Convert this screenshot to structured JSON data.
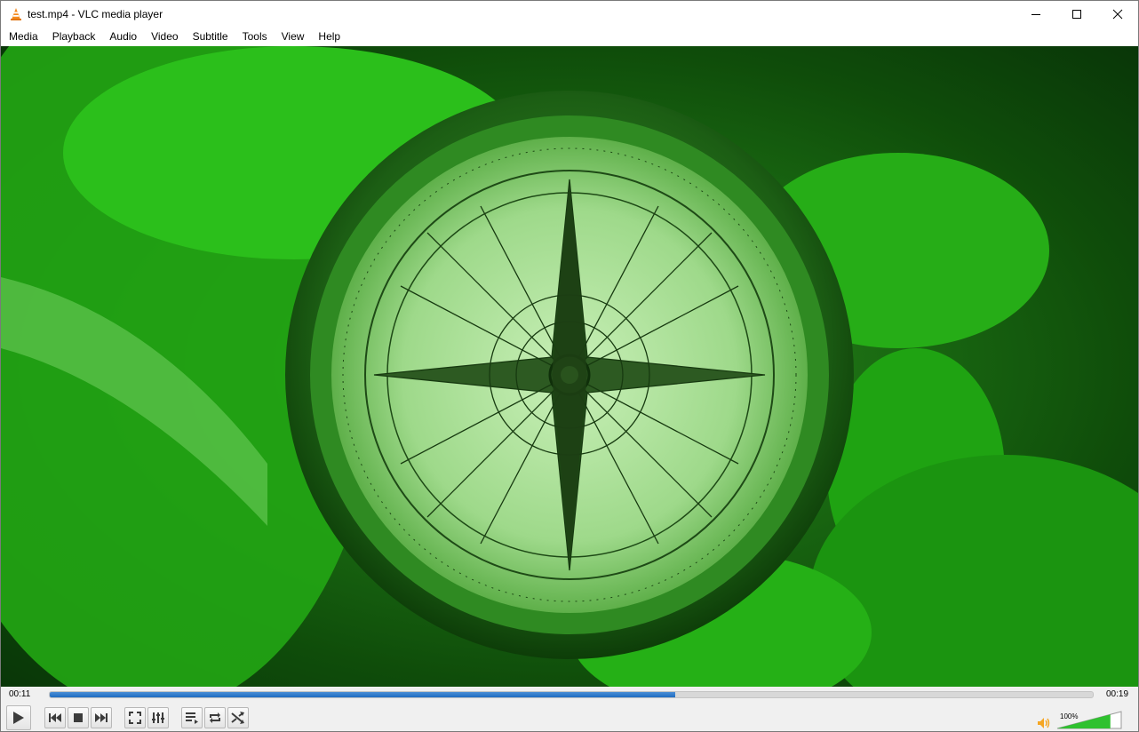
{
  "window": {
    "title": "test.mp4 - VLC media player"
  },
  "menu": [
    "Media",
    "Playback",
    "Audio",
    "Video",
    "Subtitle",
    "Tools",
    "View",
    "Help"
  ],
  "playback": {
    "elapsed": "00:11",
    "total": "00:19",
    "progress": 0.6
  },
  "volume": {
    "label": "100%",
    "level": 1.0
  },
  "colors": {
    "seek_fill": "#1f6bc0",
    "volume_fill": "#2fc12f",
    "video_tint": "#1a7a12"
  },
  "icons": {
    "app": "vlc-cone-icon",
    "minimize": "minimize-icon",
    "maximize": "maximize-icon",
    "close": "close-icon",
    "play": "play-icon",
    "previous": "skip-previous-icon",
    "stop": "stop-icon",
    "next": "skip-next-icon",
    "fullscreen": "fullscreen-icon",
    "extended": "extended-settings-icon",
    "playlist": "playlist-icon",
    "loop": "loop-icon",
    "shuffle": "shuffle-icon",
    "volume": "speaker-icon"
  }
}
